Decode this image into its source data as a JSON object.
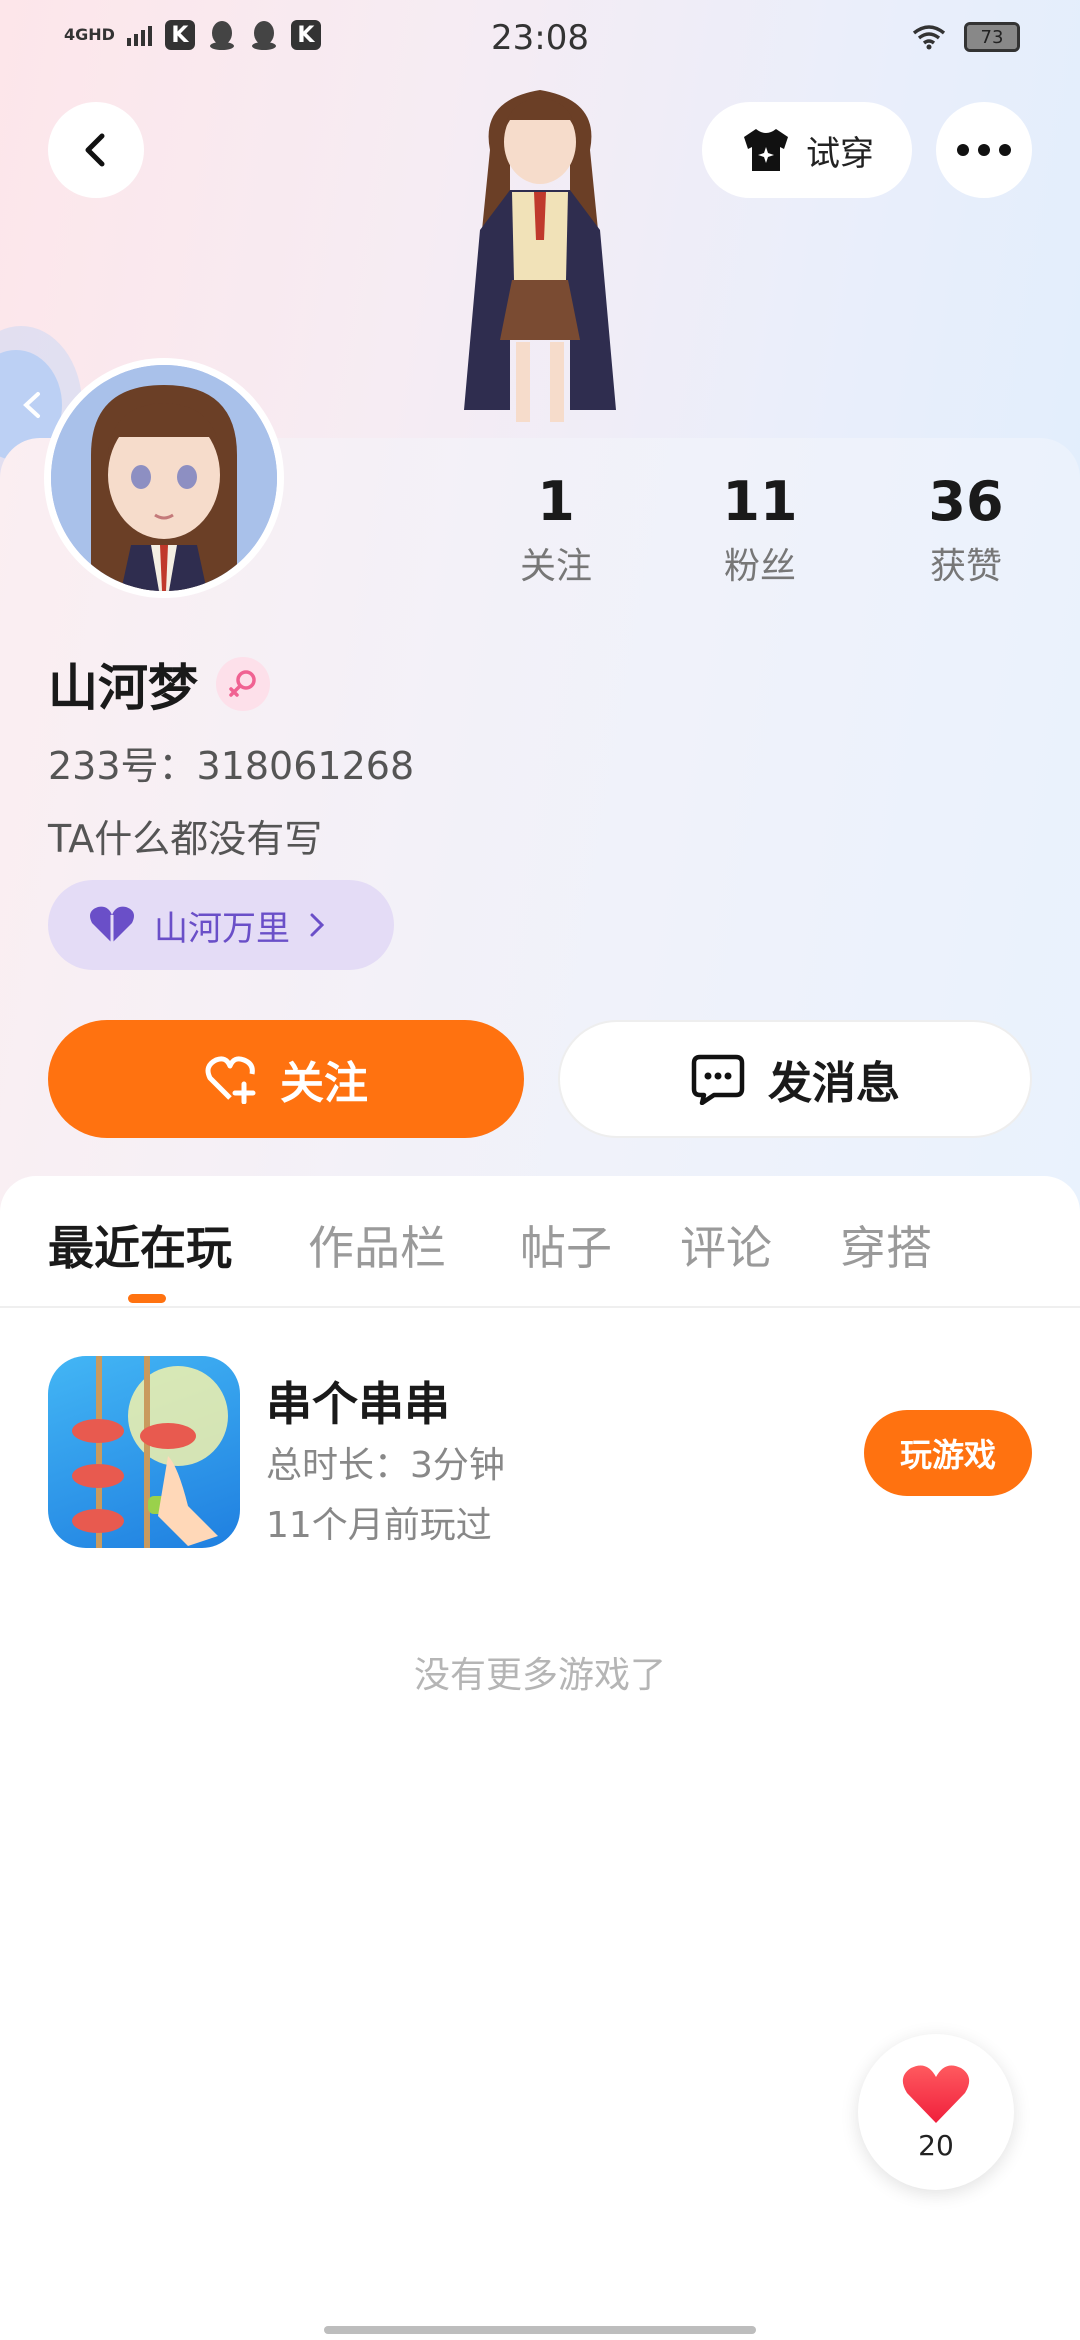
{
  "status_bar": {
    "network": "4GHD",
    "time": "23:08",
    "battery": "73",
    "k_label": "K"
  },
  "header": {
    "try_on_label": "试穿"
  },
  "profile": {
    "username": "山河梦",
    "account_id": "233号：318061268",
    "bio": "TA什么都没有写",
    "tag_label": "山河万里",
    "stats": [
      {
        "value": "1",
        "label": "关注"
      },
      {
        "value": "11",
        "label": "粉丝"
      },
      {
        "value": "36",
        "label": "获赞"
      }
    ]
  },
  "actions": {
    "follow_label": "关注",
    "message_label": "发消息"
  },
  "tabs": [
    {
      "label": "最近在玩",
      "active": true
    },
    {
      "label": "作品栏",
      "active": false
    },
    {
      "label": "帖子",
      "active": false
    },
    {
      "label": "评论",
      "active": false
    },
    {
      "label": "穿搭",
      "active": false
    }
  ],
  "games": [
    {
      "title": "串个串串",
      "duration": "总时长：3分钟",
      "last_played": "11个月前玩过",
      "play_label": "玩游戏"
    }
  ],
  "end_note": "没有更多游戏了",
  "like_fab": {
    "count": "20"
  },
  "colors": {
    "accent": "#ff7210",
    "tag_bg": "#e4dcf6",
    "tag_text": "#6a4fc8"
  }
}
